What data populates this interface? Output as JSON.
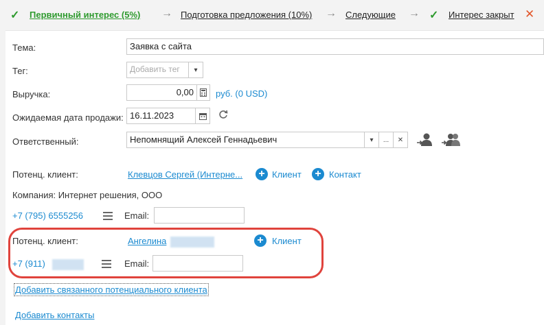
{
  "pipeline": {
    "stages": [
      {
        "label": "Первичный интерес (5%)"
      },
      {
        "label": "Подготовка предложения (10%)"
      },
      {
        "label": "Следующие"
      },
      {
        "label": "Интерес закрыт"
      }
    ]
  },
  "form": {
    "topic": {
      "label": "Тема:",
      "value": "Заявка с сайта"
    },
    "tag": {
      "label": "Тег:",
      "placeholder": "Добавить тег"
    },
    "revenue": {
      "label": "Выручка:",
      "value": "0,00",
      "currency": "руб. (0 USD)"
    },
    "sale_date": {
      "label": "Ожидаемая дата продажи:",
      "value": "16.11.2023"
    },
    "responsible": {
      "label": "Ответственный:",
      "value": "Непомнящий Алексей Геннадьевич",
      "more": "..."
    }
  },
  "lead1": {
    "label": "Потенц. клиент:",
    "name": "Клевцов Сергей (Интерне...",
    "client_btn": "Клиент",
    "contact_btn": "Контакт",
    "company": "Компания: Интернет решения, ООО",
    "phone": "+7 (795) 6555256",
    "email_label": "Email:",
    "email_value": ""
  },
  "lead2": {
    "label": "Потенц. клиент:",
    "name": "Ангелина",
    "client_btn": "Клиент",
    "phone": "+7 (911)",
    "email_label": "Email:",
    "email_value": ""
  },
  "links": {
    "add_related": "Добавить связанного потенциального клиента",
    "add_contacts": "Добавить контакты"
  },
  "colors": {
    "accent": "#1b8ad0",
    "success": "#2e9a2e",
    "highlight": "#e0433c"
  }
}
